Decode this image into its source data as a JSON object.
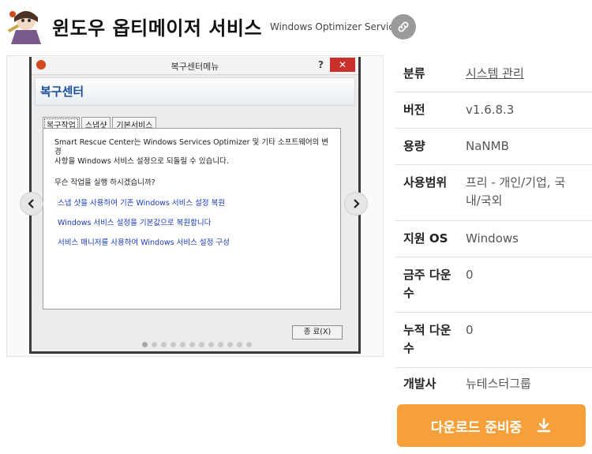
{
  "header": {
    "title": "윈도우 옵티메이저 서비스",
    "subtitle": "Windows Optimizer Service"
  },
  "screenshot": {
    "window_title": "복구센터메뉴",
    "help_symbol": "?",
    "close_symbol": "✕",
    "header_text": "복구센터",
    "tabs": [
      "복구작업",
      "스냅샷",
      "기본서비스"
    ],
    "description_line1": "Smart Rescue Center는 Windows Services Optimizer 및 기타 소프트웨어의 변경",
    "description_line2": "사항을 Windows 서비스 설정으로 되돌릴 수 있습니다.",
    "question": "무슨 작업을 실행 하시겠습니까?",
    "links": [
      "스냅 샷을 사용하여 기존 Windows 서비스 설정 복원",
      "Windows 서비스 설정을 기본값으로 복원합니다",
      "서비스 매니저를 사용하여 Windows 서비스 설정 구성"
    ],
    "ok_button": "종  료(X)"
  },
  "gallery": {
    "prev_icon": "chevron-left",
    "next_icon": "chevron-right",
    "dot_count": 12,
    "active_dot": 1
  },
  "info": {
    "rows": [
      {
        "label": "분류",
        "value": "시스템 관리",
        "link": true
      },
      {
        "label": "버전",
        "value": "v1.6.8.3"
      },
      {
        "label": "용량",
        "value": "NaNMB"
      },
      {
        "label": "사용범위",
        "value_line1": "프리 - 개인/기업, 국",
        "value_line2": "내/국외"
      },
      {
        "label": "지원 OS",
        "value": "Windows"
      },
      {
        "label_line1": "금주 다운",
        "label_line2": "수",
        "value": "0"
      },
      {
        "label_line1": "누적 다운",
        "label_line2": "수",
        "value": "0"
      },
      {
        "label": "개발사",
        "value": "뉴테스터그룹"
      }
    ]
  },
  "download": {
    "label": "다운로드 준비중",
    "icon": "download-icon"
  },
  "colors": {
    "accent": "#f5a03b",
    "link_button": "#9a9a9a",
    "window_link": "#1a3bb8",
    "window_header": "#1a4f9c"
  }
}
